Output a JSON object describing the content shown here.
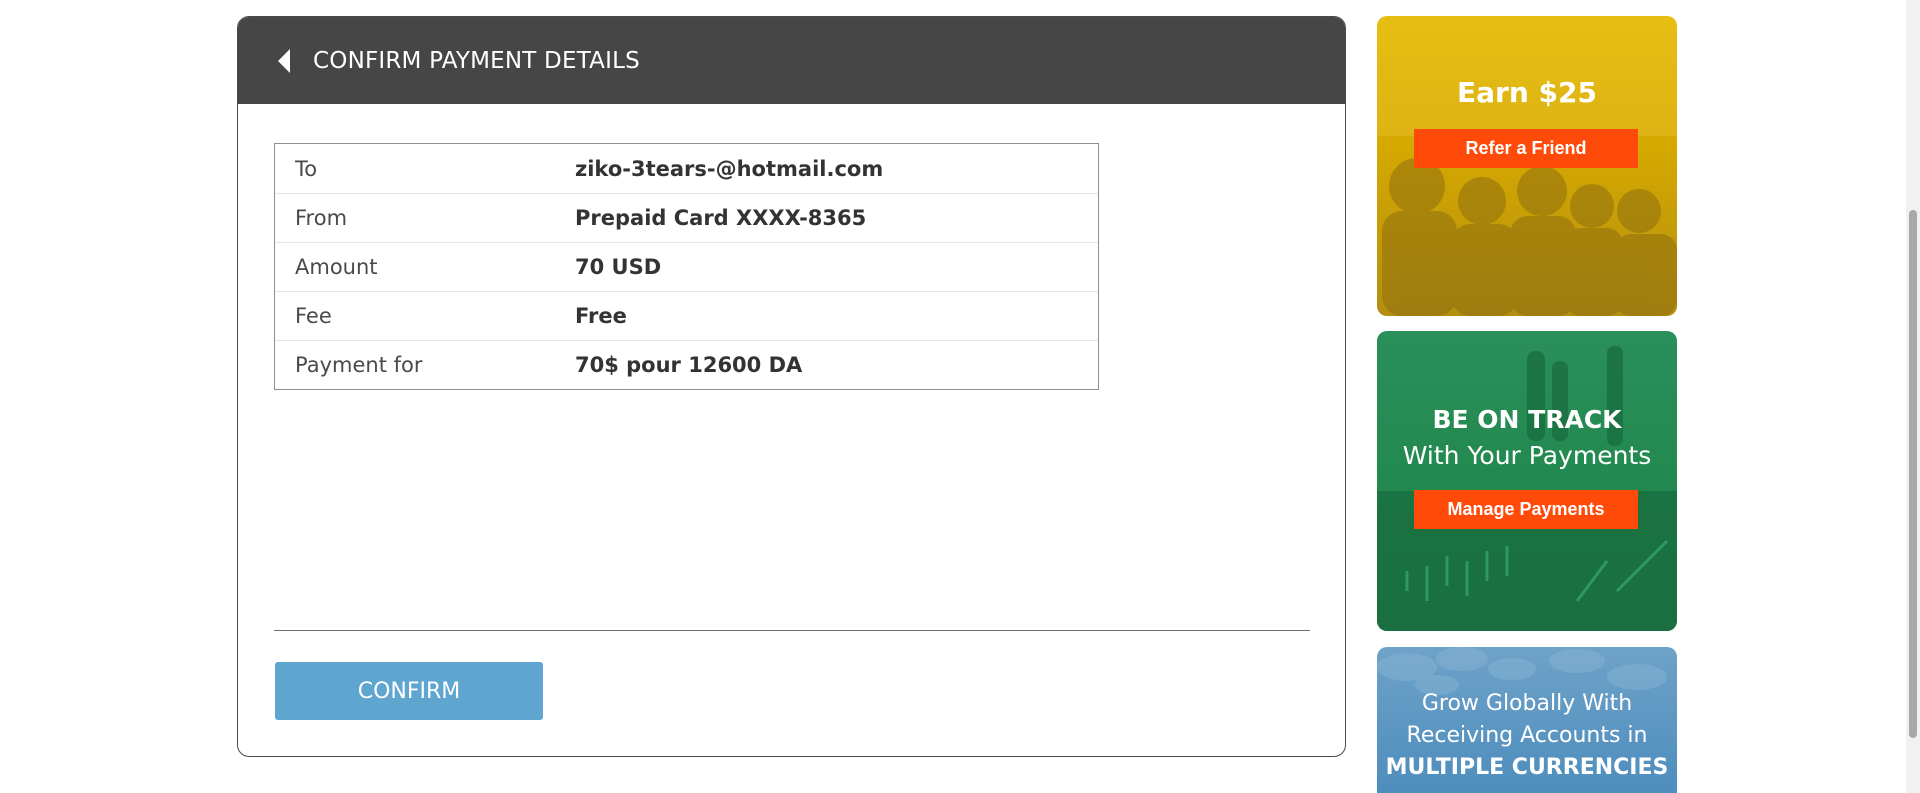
{
  "header": {
    "title": "CONFIRM PAYMENT DETAILS",
    "back_icon": "chevron-left-icon"
  },
  "details": {
    "rows": [
      {
        "label": "To",
        "value": "ziko-3tears-@hotmail.com"
      },
      {
        "label": "From",
        "value": "Prepaid Card XXXX-8365"
      },
      {
        "label": "Amount",
        "value": "70 USD"
      },
      {
        "label": "Fee",
        "value": "Free"
      },
      {
        "label": "Payment for",
        "value": "70$ pour 12600 DA"
      }
    ]
  },
  "actions": {
    "confirm_label": "CONFIRM"
  },
  "promos": {
    "refer": {
      "headline": "Earn $25",
      "button": "Refer a Friend"
    },
    "track": {
      "headline": "BE ON TRACK",
      "subhead": "With Your Payments",
      "button": "Manage Payments"
    },
    "global": {
      "line1": "Grow Globally With",
      "line2": "Receiving Accounts in",
      "line3": "MULTIPLE CURRENCIES"
    }
  },
  "colors": {
    "header_bg": "#464646",
    "confirm_bg": "#5ea5cf",
    "promo_button": "#ff4a0a",
    "promo_yellow": "#d4a800",
    "promo_green": "#22894f",
    "promo_blue": "#4e8dbd"
  }
}
